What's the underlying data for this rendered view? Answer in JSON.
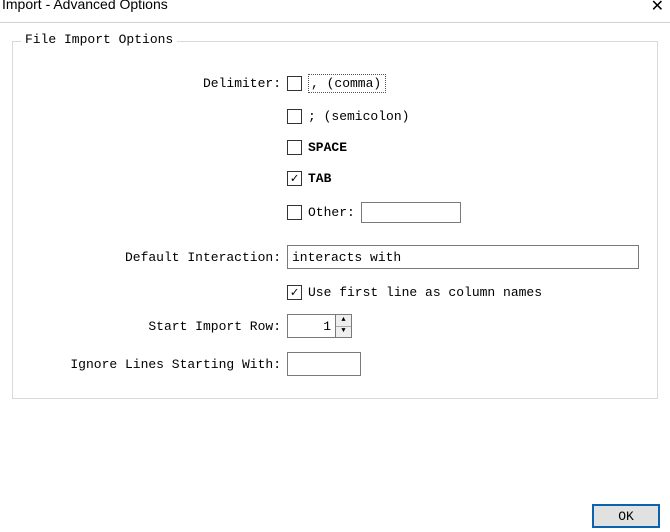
{
  "window": {
    "title": "Import - Advanced Options"
  },
  "fieldset": {
    "legend": "File Import Options"
  },
  "labels": {
    "delimiter": "Delimiter:",
    "default_interaction": "Default Interaction:",
    "start_import_row": "Start Import Row:",
    "ignore_lines": "Ignore Lines Starting With:"
  },
  "delimiters": {
    "comma_label": ", (comma)",
    "semicolon_label": "; (semicolon)",
    "space_label": "SPACE",
    "tab_label": "TAB",
    "other_label": "Other:",
    "comma_checked": false,
    "semicolon_checked": false,
    "space_checked": false,
    "tab_checked": true,
    "other_checked": false,
    "other_value": ""
  },
  "default_interaction_value": "interacts with",
  "use_first_line": {
    "label": "Use first line as column names",
    "checked": true
  },
  "start_row_value": "1",
  "ignore_value": "",
  "buttons": {
    "ok": "OK"
  }
}
